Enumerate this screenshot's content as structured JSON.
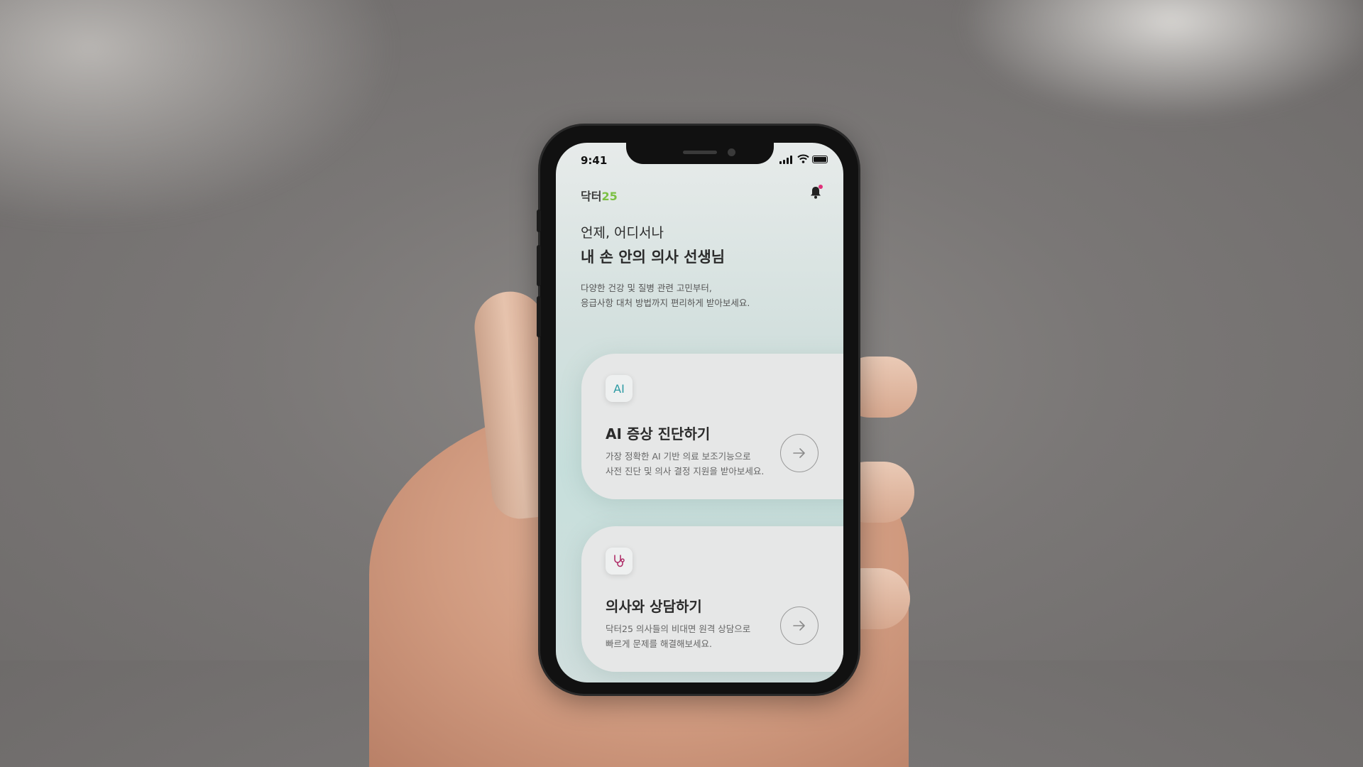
{
  "status_bar": {
    "time": "9:41"
  },
  "header": {
    "logo_text": "닥터",
    "logo_number": "25"
  },
  "hero": {
    "line1": "언제, 어디서나",
    "line2": "내 손 안의 의사 선생님",
    "desc_line1": "다양한 건강 및 질병 관련 고민부터,",
    "desc_line2": "응급사항 대처 방법까지 편리하게 받아보세요."
  },
  "cards": [
    {
      "icon_label": "AI",
      "icon": "ai-badge-icon",
      "title": "AI 증상 진단하기",
      "desc_line1": "가장 정확한 AI 기반 의료 보조기능으로",
      "desc_line2": "사전 진단 및 의사 결정 지원을 받아보세요."
    },
    {
      "icon": "stethoscope-icon",
      "title": "의사와 상담하기",
      "desc_line1": "닥터25 의사들의 비대면 원격 상담으로",
      "desc_line2": "빠르게 문제를 해결해보세요."
    }
  ],
  "colors": {
    "brand_green": "#7bc043",
    "ai_teal": "#2c9aa3",
    "stethoscope": "#b0306a",
    "notification_dot": "#e0307a"
  }
}
